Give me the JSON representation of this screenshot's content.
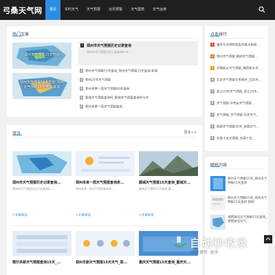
{
  "header": {
    "logo": "弓桑天气网",
    "nav": [
      "首页",
      "实时天气",
      "天气预报",
      "台风预警",
      "天气图表",
      "天气运用"
    ],
    "active_index": 0
  },
  "hot": {
    "title": "热门文章",
    "featured": {
      "num": "1",
      "title": "郑州市天气预报历史记录查询",
      "desc": "郑州市天气预报历史记录查询&nb..."
    },
    "list": [
      {
        "num": "2",
        "text": "郑州天气预报15天查询_郑州天气预报15天查询 新闻"
      },
      {
        "num": "3",
        "text": "郑州25号天气预报"
      },
      {
        "num": "4",
        "text": "郑州未来一周天气预报60天查询"
      },
      {
        "num": "5",
        "text": "鄞城天气预报查询吗_鄞城天气预报查询吗今天"
      },
      {
        "num": "6",
        "text": "郑州未来一周天气预报查询"
      }
    ],
    "thumb_caption_1": "郑州天气预报15天查询",
    "thumb_caption_2a": "郑州天气预报15天查询_郑州",
    "thumb_caption_2b": "天气预报15天查询 新闻"
  },
  "news": {
    "title": "资讯",
    "more": "更多>>",
    "tiles": [
      {
        "title": "郑州市天气预报历史记录查询...",
        "desc": "郑州市天气预报历史记录查询&...",
        "link": "+文章阅读"
      },
      {
        "title": "郑州未来一周天气预报查询表...",
        "desc": "郑州未来一周天气预报查询表...",
        "link": "+文章阅读"
      },
      {
        "title": "鄞城天气预报15天查询_鄞城天...",
        "desc": "鄞城天气预报15天查询_鄞...",
        "link": "+文章阅读"
      },
      {
        "title": "鄂尔多斯天气预报查询15天_...",
        "desc": "",
        "link": ""
      },
      {
        "title": "郑州华斯天气预报15天天气_郑...",
        "desc": "",
        "link": ""
      },
      {
        "title": "重庆天气预报15天查询_重庆天...",
        "desc": "",
        "link": ""
      }
    ]
  },
  "rank": {
    "title": "点击排行",
    "items": [
      {
        "num": "1",
        "text": "重庆今天预防发生的重大新闻...",
        "color": "#e74c3c"
      },
      {
        "num": "2",
        "text": "郑州天气预报 南阳天气预报...",
        "color": "#e67e22"
      },
      {
        "num": "3",
        "text": "河南新乡天气预报_南阳新乡天...",
        "color": "#f39c12"
      },
      {
        "num": "4",
        "text": "北京天气预报今天明天_北京天...",
        "color": "#aaa"
      },
      {
        "num": "5",
        "text": "浙江20天天气预报_浙江20天...",
        "color": "#aaa"
      },
      {
        "num": "6",
        "text": "天气预报 中央台天气预报...",
        "color": "#aaa"
      },
      {
        "num": "7",
        "text": "天气预报_天气预报 历史天气...",
        "color": "#aaa"
      },
      {
        "num": "8",
        "text": "陕西天气预报30天_陕西天气...",
        "color": "#aaa"
      },
      {
        "num": "9",
        "text": "长春十五天预报_长春十五...",
        "color": "#aaa"
      }
    ]
  },
  "random": {
    "title": "随机内容",
    "items": [
      {
        "text": "郑州天气预报15天_郑州天气预报15天查询"
      },
      {
        "text": "郑州天气预报15天_郑州天气预报15天查询 新闻"
      },
      {
        "text": "湖南湖北天气预报15天查询_湖南湖北天气..."
      }
    ]
  },
  "watermark": {
    "title": "自动秒收录",
    "sub": "·收录更快 ·更多·"
  }
}
